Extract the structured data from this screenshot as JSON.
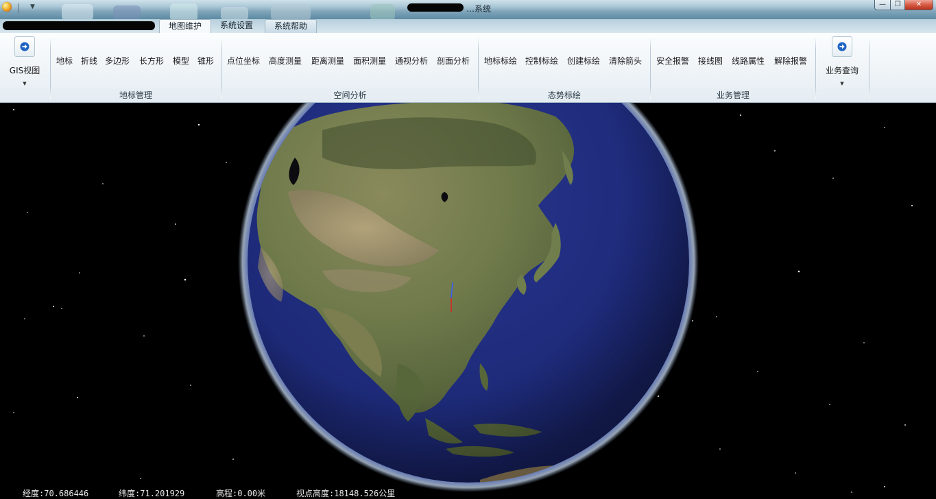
{
  "titlebar": {
    "title": "…系统",
    "controls": {
      "minimize": "—",
      "restore": "❐",
      "close": "✕"
    }
  },
  "tabs": [
    {
      "label": "地图维护",
      "active": true
    },
    {
      "label": "系统设置",
      "active": false
    },
    {
      "label": "系统帮助",
      "active": false
    }
  ],
  "ribbon": {
    "gis_view": {
      "label": "GIS视图",
      "icon": "arrow-right-circle-icon"
    },
    "landmark": {
      "label": "地标管理",
      "buttons": [
        "地标",
        "折线",
        "多边形",
        "长方形",
        "模型",
        "锥形"
      ]
    },
    "spatial": {
      "label": "空间分析",
      "buttons": [
        "点位坐标",
        "高度测量",
        "距离测量",
        "面积测量",
        "通视分析",
        "剖面分析"
      ]
    },
    "situation": {
      "label": "态势标绘",
      "buttons": [
        "地标标绘",
        "控制标绘",
        "创建标绘",
        "清除箭头"
      ]
    },
    "business": {
      "label": "业务管理",
      "buttons": [
        "安全报警",
        "接线图",
        "线路属性",
        "解除报警"
      ]
    },
    "business_query": {
      "label": "业务查询",
      "icon": "arrow-right-circle-icon"
    }
  },
  "status": {
    "longitude": "经度:70.686446",
    "latitude": "纬度:71.201929",
    "altitude": "高程:0.00米",
    "view_height": "视点高度:18148.526公里"
  },
  "colors": {
    "space": "#000000",
    "ocean": "#1e2a6e",
    "atmosphere": "#6d86c9",
    "ribbon_bg": "#eef3f7",
    "title_bg": "#7fa4b9"
  }
}
